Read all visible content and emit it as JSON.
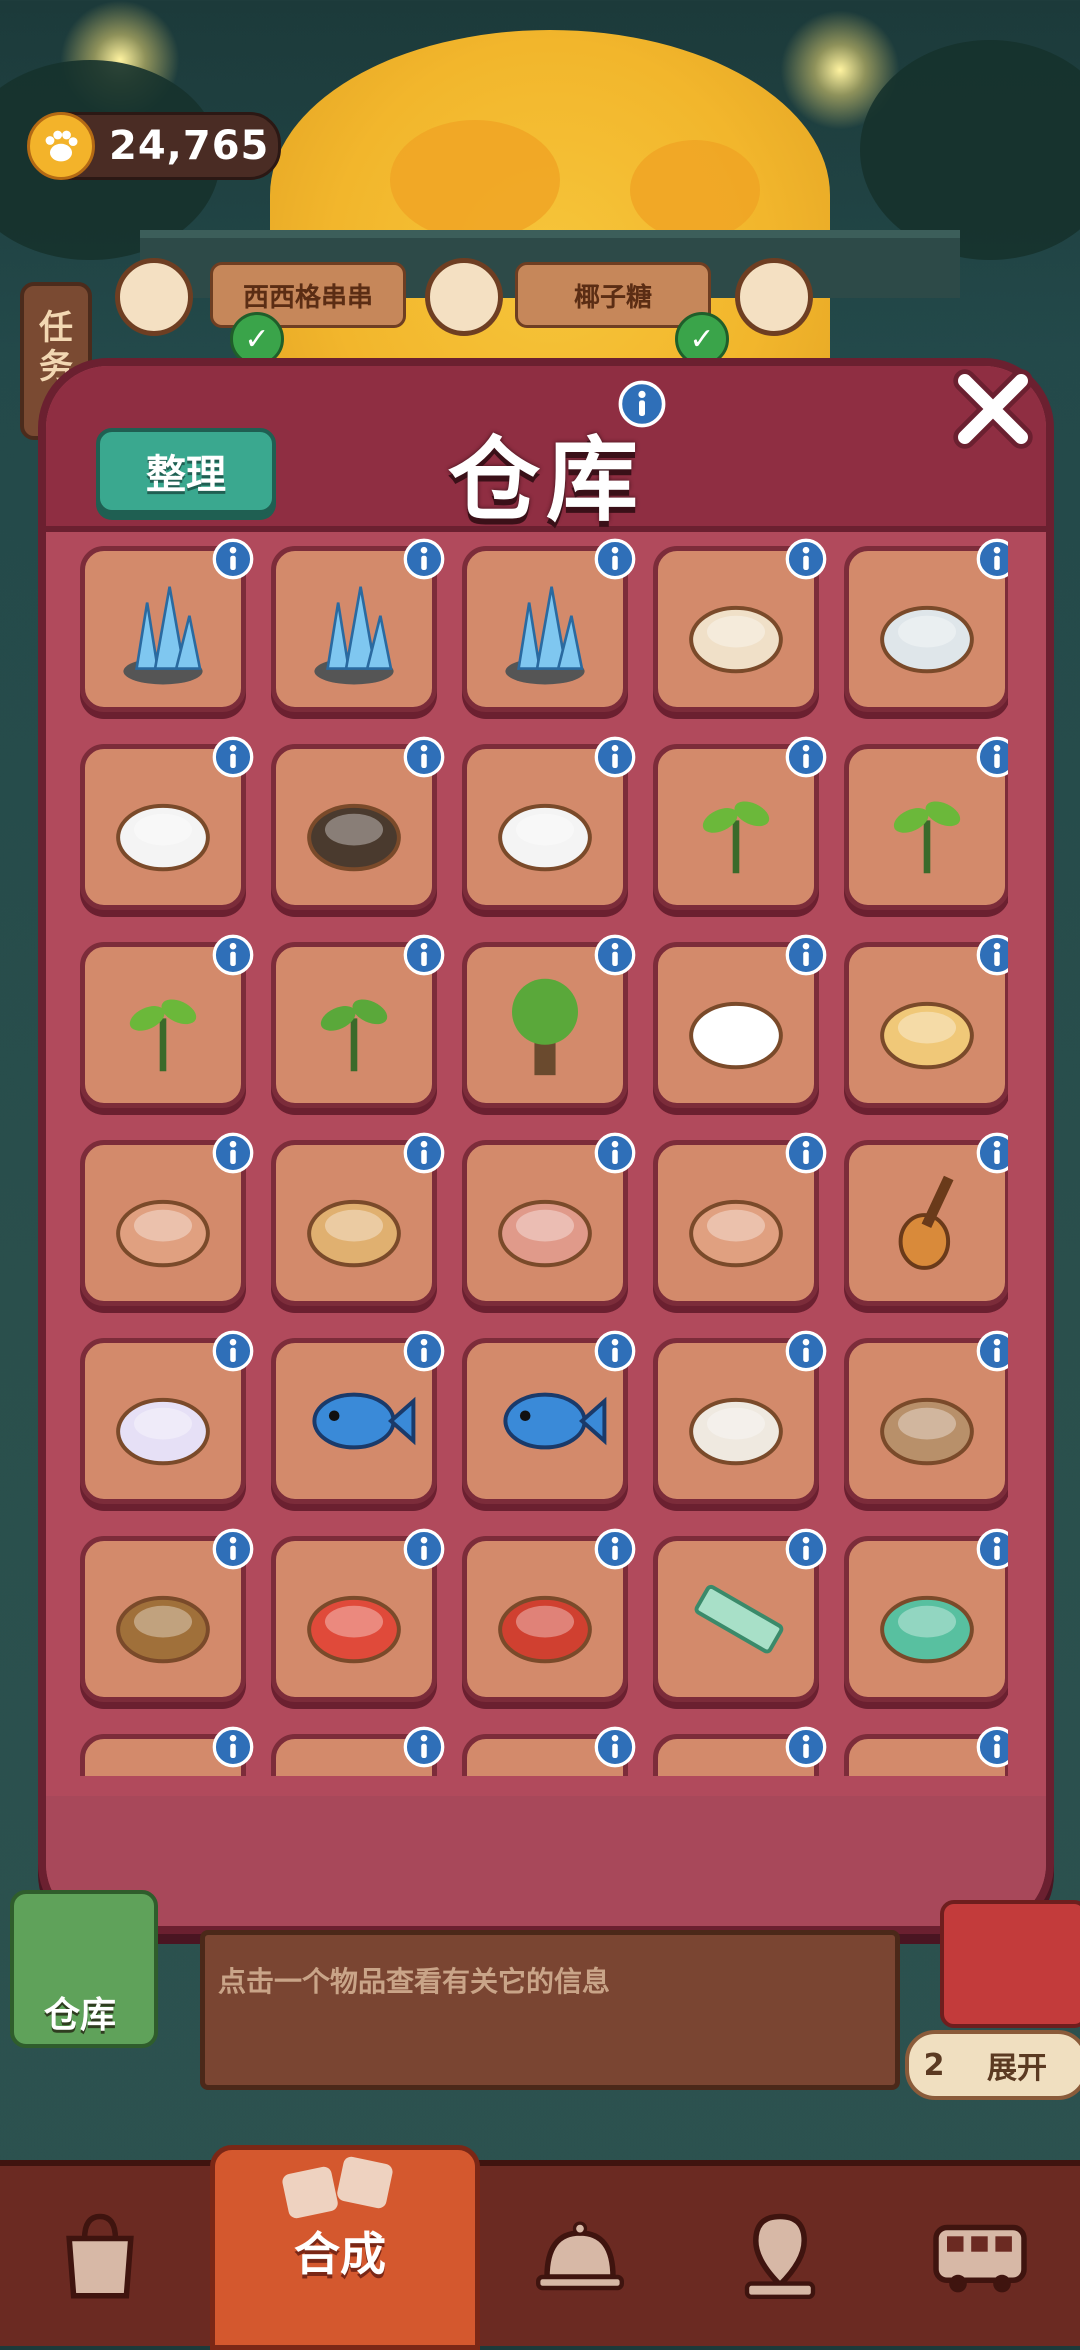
{
  "currency": {
    "amount": "24,765",
    "icon": "paw-icon"
  },
  "task_tab": {
    "line1": "任",
    "line2": "务"
  },
  "orders": [
    {
      "label": "西西格串串",
      "icon": "skewer-icon"
    },
    {
      "label": "椰子糖",
      "icon": "candy-icon"
    }
  ],
  "warehouse": {
    "title": "仓库",
    "tidy_label": "整理",
    "items": [
      "crystal-small-icon",
      "crystal-medium-icon",
      "crystal-large-icon",
      "soup-bowl-icon",
      "clay-pot-icon",
      "paper-sheets-icon",
      "wall-hook-icon",
      "paper-stack-icon",
      "seed-icon",
      "sprout-seed-icon",
      "seedling-icon",
      "young-tea-plant-icon",
      "tea-tree-icon",
      "chef-hat-icon",
      "scallion-pancake-icon",
      "scallion-bread-icon",
      "herb-board-icon",
      "meat-plate-icon",
      "tea-leaf-tray-icon",
      "guitar-icon",
      "fan-icon",
      "silver-fish-icon",
      "tropical-fish-icon",
      "tea-sack-icon",
      "tea-mat-icon",
      "tea-basket-icon",
      "tea-scroll-icon",
      "sedan-chair-icon",
      "ruler-icon",
      "tape-measure-icon",
      "partial-item-icon",
      "partial-item-icon",
      "partial-item-icon",
      "partial-item-icon",
      "partial-item-icon"
    ]
  },
  "hint": {
    "text": "点击一个物品查看有关它的信息"
  },
  "side_warehouse": {
    "label": "仓库"
  },
  "expand": {
    "count": "2",
    "label": "展开"
  },
  "nav": {
    "active_label": "合成",
    "items": [
      "shopping-bag-icon",
      "merge-icon",
      "service-bell-icon",
      "map-pin-icon",
      "bus-icon"
    ]
  },
  "colors": {
    "panel": "#b14a5c",
    "header": "#8f2e42",
    "cell": "#d38a6b",
    "tidy": "#3aa88f",
    "info": "#2f6fb8"
  }
}
